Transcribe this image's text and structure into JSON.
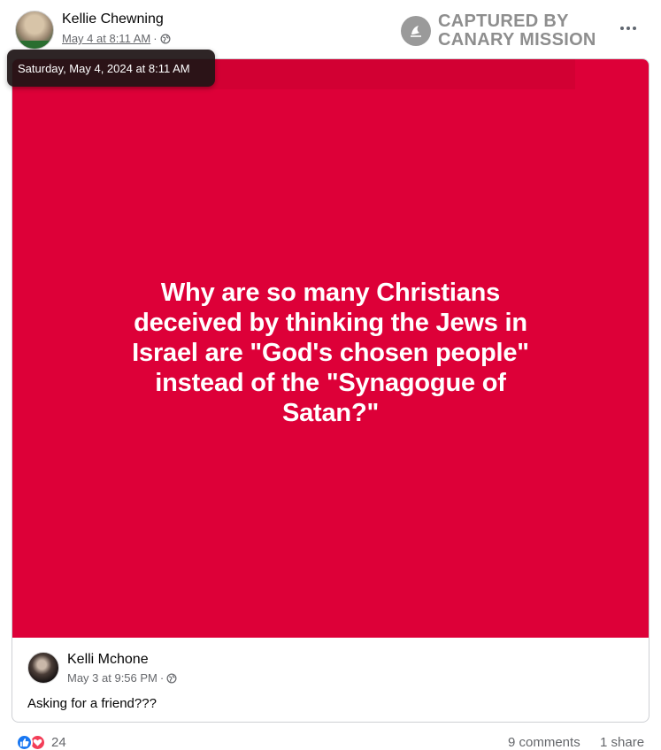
{
  "post": {
    "author": "Kellie Chewning",
    "timestamp": "May 4 at 8:11 AM",
    "visibility_icon": "globe-icon",
    "tooltip": "Saturday, May 4, 2024 at 8:11 AM"
  },
  "watermark": {
    "line1": "CAPTURED BY",
    "line2": "CANARY MISSION"
  },
  "shared_post": {
    "image_text": "Why are so many Christians deceived by thinking the Jews in Israel are \"God's chosen people\" instead of the \"Synagogue of Satan?\"",
    "image_background": "#dd0038",
    "author": "Kelli Mchone",
    "timestamp": "May 3 at 9:56 PM",
    "caption": "Asking for a friend???"
  },
  "footer": {
    "reaction_count": "24",
    "comments": "9 comments",
    "shares": "1 share"
  },
  "colors": {
    "like_blue": "#1877f2",
    "love_red": "#f33e58",
    "meta_gray": "#65676b"
  }
}
